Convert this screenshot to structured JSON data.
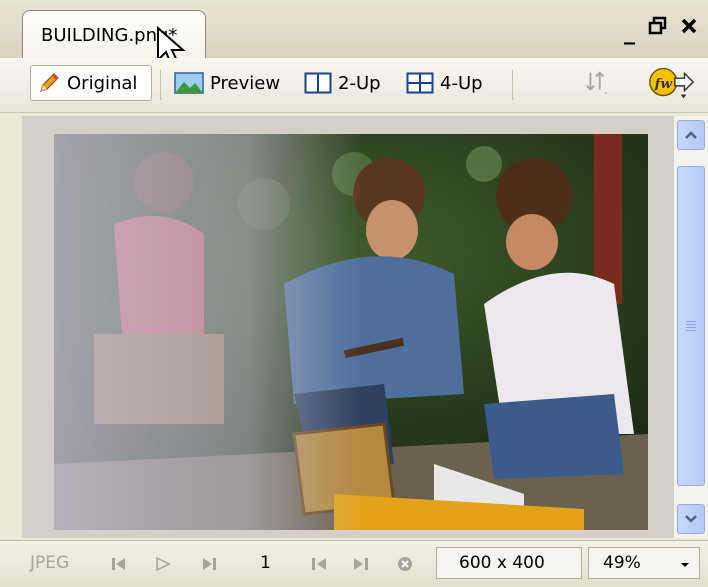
{
  "document_tab": {
    "title": "BUILDING.png*"
  },
  "window_controls": {
    "minimize": "_",
    "restore": "🗗",
    "close": "✕"
  },
  "toolbar": {
    "original_label": "Original",
    "preview_label": "Preview",
    "two_up_label": "2-Up",
    "four_up_label": "4-Up"
  },
  "icons": {
    "original": "pencil-icon",
    "preview": "landscape-image-icon",
    "two_up": "two-up-view-icon",
    "four_up": "four-up-view-icon",
    "export": "sort-arrows-icon",
    "fireworks": "fireworks-logo-icon"
  },
  "status_bar": {
    "format": "JPEG",
    "frame": "1",
    "dimensions": "600 x 400",
    "zoom": "49%"
  },
  "colors": {
    "accent_scroll": "#b6cbf7",
    "tab_bg": "#ffffff",
    "chrome": "#ece9d8"
  }
}
